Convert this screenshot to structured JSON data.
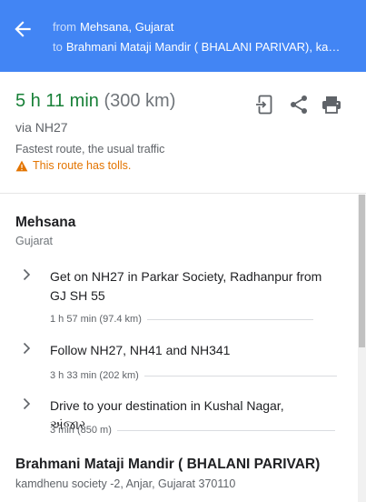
{
  "header": {
    "from_prefix": "from",
    "from_place": "Mehsana, Gujarat",
    "to_prefix": "to",
    "to_place": "Brahmani Mataji Mandir ( BHALANI PARIVAR), kam..."
  },
  "summary": {
    "duration": "5 h 11 min",
    "distance": "(300 km)",
    "via": "via NH27",
    "note": "Fastest route, the usual traffic",
    "warning": "This route has tolls."
  },
  "origin": {
    "title": "Mehsana",
    "subtitle": "Gujarat"
  },
  "steps": [
    {
      "text": "Get on NH27 in Parkar Society, Radhanpur from GJ SH 55",
      "meta": "1 h 57 min (97.4 km)"
    },
    {
      "text": "Follow NH27, NH41 and NH341",
      "meta": "3 h 33 min (202 km)"
    },
    {
      "text": "Drive to your destination in Kushal Nagar, અંજાર",
      "meta": "3 min (850 m)"
    }
  ],
  "destination": {
    "title": "Brahmani Mataji Mandir ( BHALANI PARIVAR)",
    "subtitle": "kamdhenu society -2, Anjar, Gujarat 370110"
  },
  "icons": {
    "back": "arrow-back-icon",
    "send": "send-to-device-icon",
    "share": "share-icon",
    "print": "print-icon",
    "warning": "warning-icon",
    "chevron": "chevron-right-icon"
  },
  "colors": {
    "header": "#4285f4",
    "duration": "#188038",
    "warning": "#e37400"
  }
}
